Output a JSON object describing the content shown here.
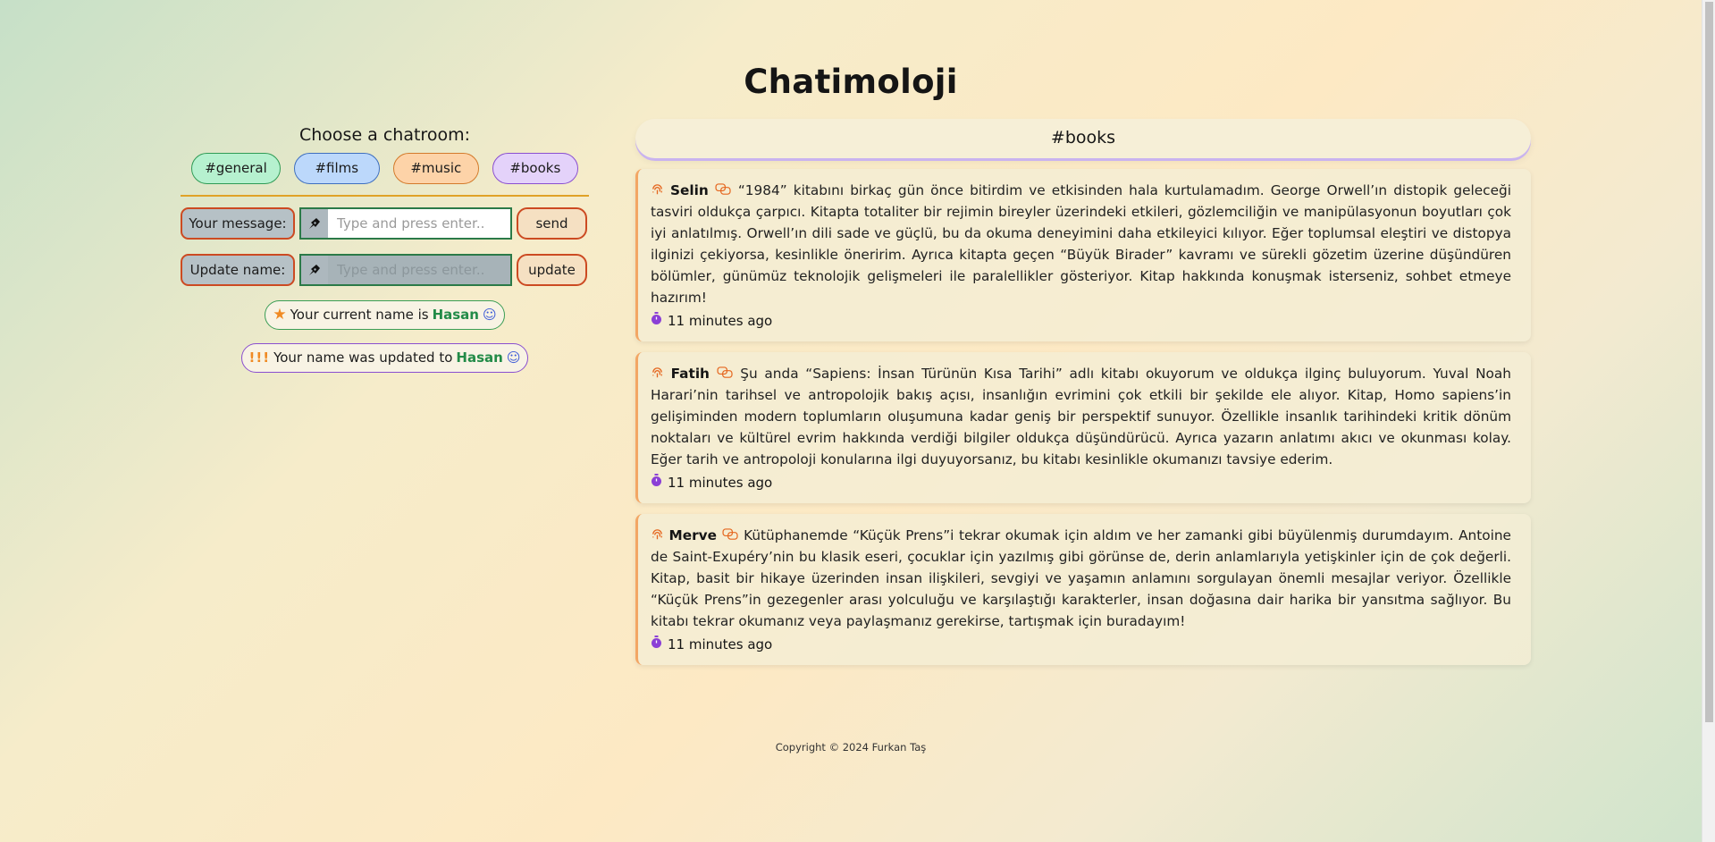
{
  "app": {
    "title": "Chatimoloji"
  },
  "sidebar": {
    "choose_label": "Choose a chatroom:",
    "rooms": [
      {
        "label": "#general",
        "color": "#b6f1cf"
      },
      {
        "label": "#films",
        "color": "#bcd8fb"
      },
      {
        "label": "#music",
        "color": "#fdd3a8"
      },
      {
        "label": "#books",
        "color": "#e4d2fa"
      }
    ],
    "message_label": "Your message:",
    "message_placeholder": "Type and press enter..",
    "message_value": "",
    "send_label": "send",
    "name_label": "Update name:",
    "name_placeholder": "Type and press enter..",
    "name_value": "",
    "update_label": "update",
    "current_name_prefix": "Your current name is",
    "current_name": "Hasan",
    "updated_prefix": "!!!",
    "updated_text": "Your name was updated to",
    "updated_name": "Hasan"
  },
  "room": {
    "name": "#books"
  },
  "messages": [
    {
      "user": "Selin",
      "text": "“1984” kitabını birkaç gün önce bitirdim ve etkisinden hala kurtulamadım. George Orwell’ın distopik geleceği tasviri oldukça çarpıcı. Kitapta totaliter bir rejimin bireyler üzerindeki etkileri, gözlemciliğin ve manipülasyonun boyutları çok iyi anlatılmış. Orwell’ın dili sade ve güçlü, bu da okuma deneyimini daha etkileyici kılıyor. Eğer toplumsal eleştiri ve distopya ilginizi çekiyorsa, kesinlikle öneririm. Ayrıca kitapta geçen “Büyük Birader” kavramı ve sürekli gözetim üzerine düşündüren bölümler, günümüz teknolojik gelişmeleri ile paralellikler gösteriyor. Kitap hakkında konuşmak isterseniz, sohbet etmeye hazırım!",
      "time": "11 minutes ago"
    },
    {
      "user": "Fatih",
      "text": "Şu anda “Sapiens: İnsan Türünün Kısa Tarihi” adlı kitabı okuyorum ve oldukça ilginç buluyorum. Yuval Noah Harari’nin tarihsel ve antropolojik bakış açısı, insanlığın evrimini çok etkili bir şekilde ele alıyor. Kitap, Homo sapiens’in gelişiminden modern toplumların oluşumuna kadar geniş bir perspektif sunuyor. Özellikle insanlık tarihindeki kritik dönüm noktaları ve kültürel evrim hakkında verdiği bilgiler oldukça düşündürücü. Ayrıca yazarın anlatımı akıcı ve okunması kolay. Eğer tarih ve antropoloji konularına ilgi duyuyorsanız, bu kitabı kesinlikle okumanızı tavsiye ederim.",
      "time": "11 minutes ago"
    },
    {
      "user": "Merve",
      "text": "Kütüphanemde “Küçük Prens”i tekrar okumak için aldım ve her zamanki gibi büyülenmiş durumdayım. Antoine de Saint-Exupéry’nin bu klasik eseri, çocuklar için yazılmış gibi görünse de, derin anlamlarıyla yetişkinler için de çok değerli. Kitap, basit bir hikaye üzerinden insan ilişkileri, sevgiyi ve yaşamın anlamını sorgulayan önemli mesajlar veriyor. Özellikle “Küçük Prens”in gezegenler arası yolculuğu ve karşılaştığı karakterler, insan doğasına dair harika bir yansıtma sağlıyor. Bu kitabı tekrar okumanız veya paylaşmanız gerekirse, tartışmak için buradayım!",
      "time": "11 minutes ago"
    }
  ],
  "icons": {
    "fingerprint": "fingerprint-icon",
    "chat": "chat-bubbles-icon",
    "clock": "stopwatch-icon",
    "pen": "pen-nib-icon",
    "star": "star-icon",
    "smile": "smile-icon"
  },
  "footer": {
    "text": "Copyright © 2024 Furkan Taş"
  }
}
